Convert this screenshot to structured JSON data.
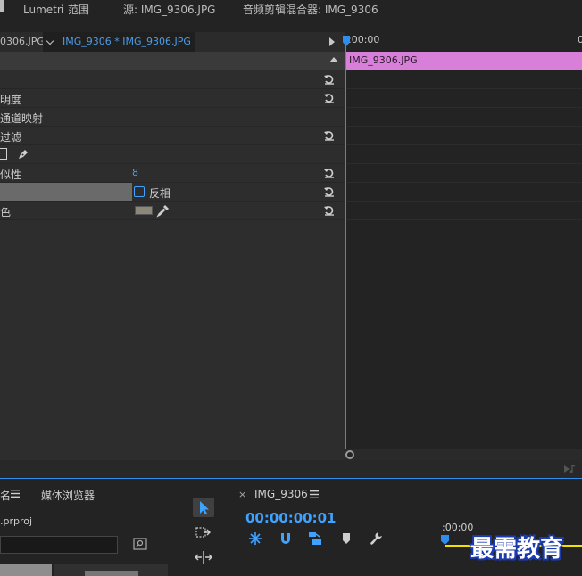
{
  "top_tabs": [
    {
      "label": "Lumetri 范围"
    },
    {
      "label": "源: IMG_9306.JPG"
    },
    {
      "label": "音频剪辑混合器: IMG_9306"
    }
  ],
  "sub_tabs": {
    "left_clip": "0306.JPG",
    "active_clip": "IMG_9306 * IMG_9306.JPG"
  },
  "ruler": {
    "start": ":00:00",
    "end": "0"
  },
  "clip_name": "IMG_9306.JPG",
  "effect_rows": [
    {
      "label": ""
    },
    {
      "label": ""
    },
    {
      "label": "明度"
    },
    {
      "label": "通道映射"
    },
    {
      "label": "过滤"
    },
    {
      "label": ""
    },
    {
      "label": "似性",
      "value": "8"
    },
    {
      "label": "",
      "checkbox_label": "反相"
    },
    {
      "label": "色"
    }
  ],
  "project": {
    "tab_name": "名",
    "tab_media_browser": "媒体浏览器",
    "file": ".prproj"
  },
  "sequence": {
    "tab_name": "IMG_9306",
    "timecode": "00:00:00:01",
    "ruler_start": ":00:00"
  },
  "watermark": "最需教育",
  "colors": {
    "accent": "#2f8ded",
    "clip": "#d880d9",
    "timecode": "#3fa2ff",
    "work_area": "#f2e200"
  },
  "icons": [
    "reset-icon",
    "pen-icon",
    "eyedropper-icon",
    "selection-tool-icon",
    "track-select-icon",
    "ripple-edit-icon",
    "snap-icon",
    "linked-select-icon",
    "marker-icon",
    "wrench-icon",
    "settings-icon"
  ]
}
